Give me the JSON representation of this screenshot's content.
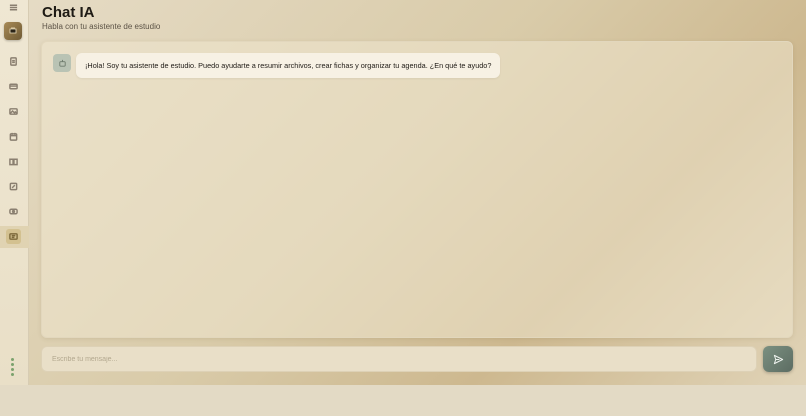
{
  "header": {
    "title": "Chat IA",
    "subtitle": "Habla con tu asistente de estudio"
  },
  "sidebar": {
    "items": [
      {
        "icon": "menu-icon"
      },
      {
        "icon": "app-logo-icon"
      },
      {
        "icon": "document-icon"
      },
      {
        "icon": "card-icon"
      },
      {
        "icon": "image-icon"
      },
      {
        "icon": "calendar-icon"
      },
      {
        "icon": "book-icon"
      },
      {
        "icon": "edit-icon"
      },
      {
        "icon": "tag-icon"
      },
      {
        "icon": "chat-icon",
        "active": true
      }
    ],
    "status_dots": 4
  },
  "chat": {
    "messages": [
      {
        "sender": "assistant",
        "text": "¡Hola! Soy tu asistente de estudio. Puedo ayudarte a resumir archivos, crear fichas y organizar tu agenda. ¿En qué te ayudo?"
      }
    ]
  },
  "composer": {
    "placeholder": "Escribe tu mensaje...",
    "value": "",
    "send_icon": "send-icon"
  },
  "colors": {
    "accent": "#5c6c62",
    "active_sidebar": "#d3c190",
    "status_dot": "#7ca26d"
  }
}
